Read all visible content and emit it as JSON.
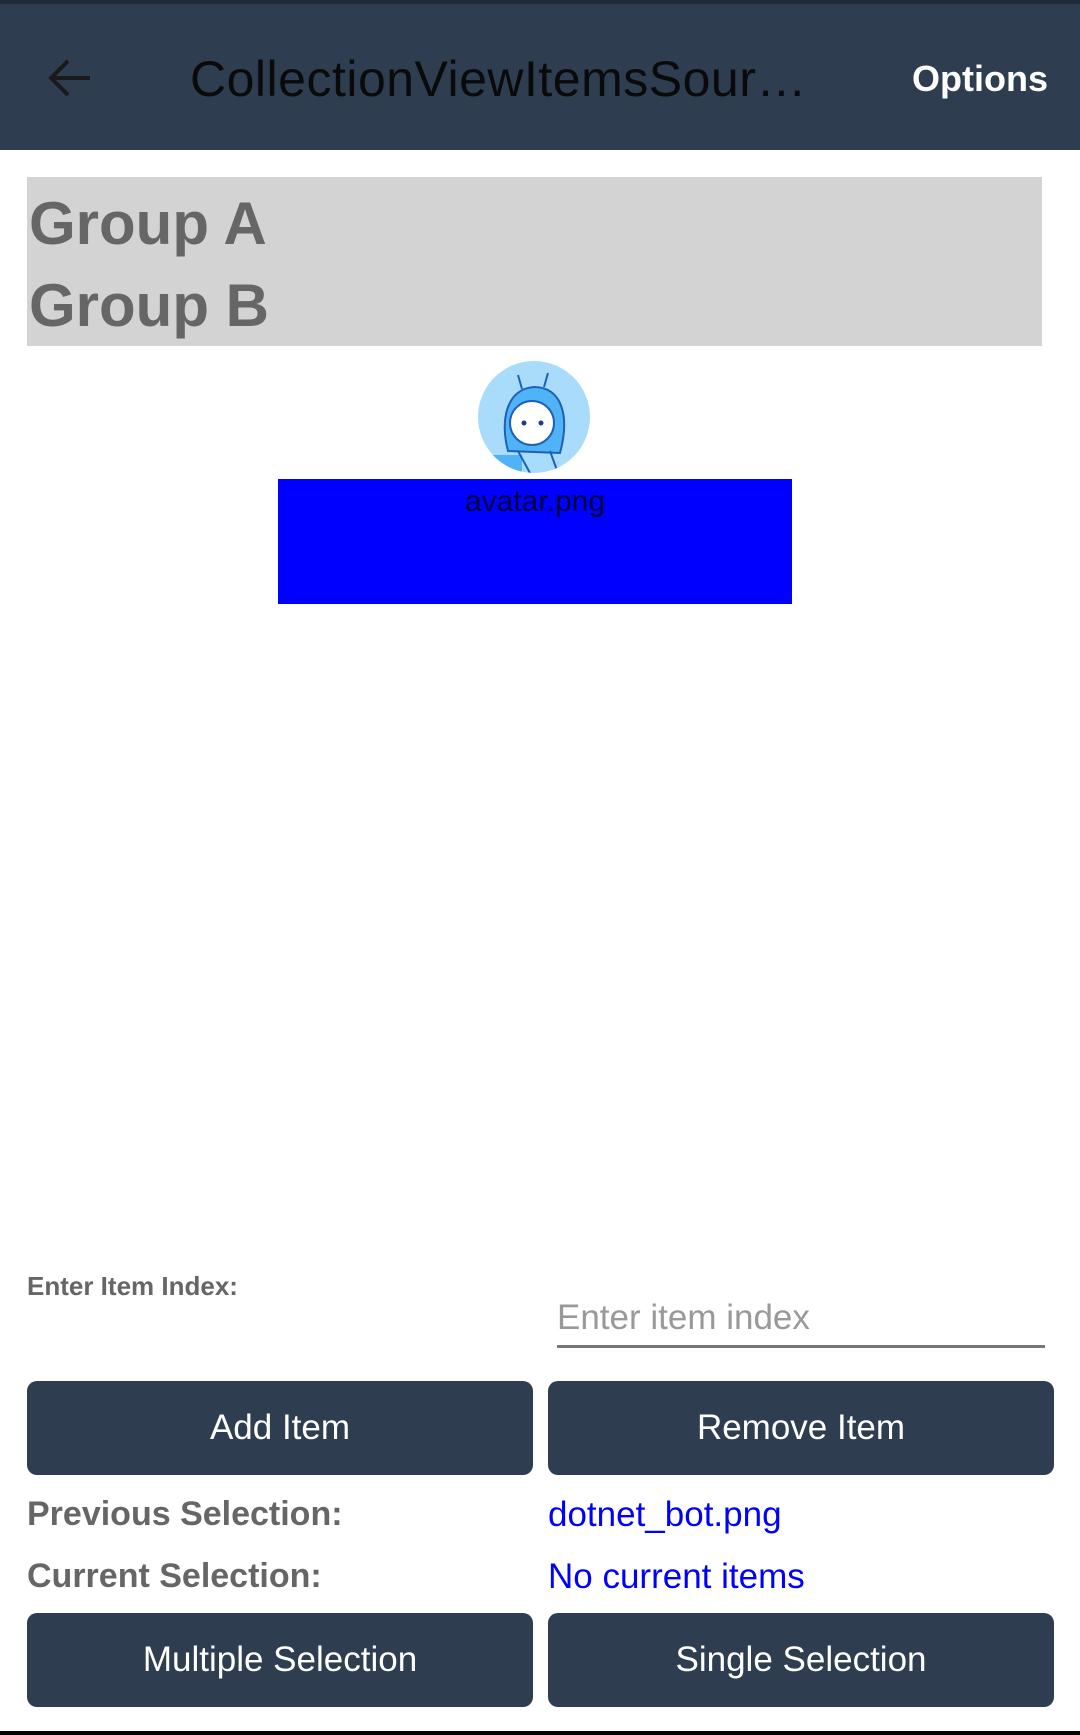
{
  "header": {
    "title": "CollectionViewItemsSour…",
    "options_label": "Options"
  },
  "groups": [
    "Group A",
    "Group B"
  ],
  "item": {
    "image_label": "avatar.png"
  },
  "index": {
    "label": "Enter Item Index:",
    "placeholder": "Enter item index",
    "value": ""
  },
  "buttons": {
    "add": "Add Item",
    "remove": "Remove Item",
    "multiple": "Multiple Selection",
    "single": "Single Selection"
  },
  "selection": {
    "previous_label": "Previous Selection:",
    "previous_value": "dotnet_bot.png",
    "current_label": "Current Selection:",
    "current_value": "No current items"
  },
  "colors": {
    "header": "#2e3e50",
    "accent": "#0000ff",
    "group_bg": "#d3d3d3"
  }
}
